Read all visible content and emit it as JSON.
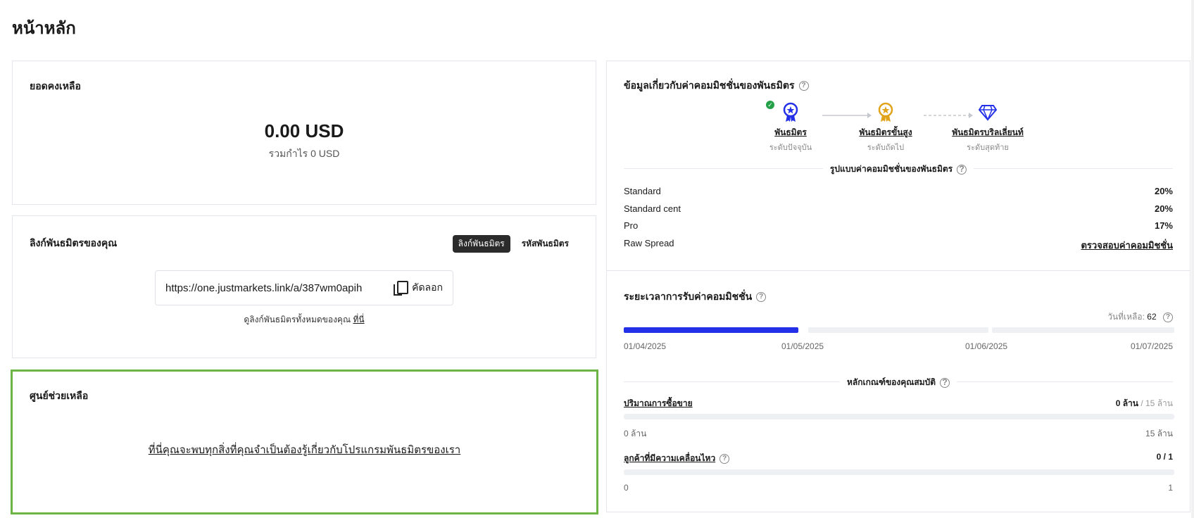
{
  "page": {
    "title": "หน้าหลัก"
  },
  "balance": {
    "title": "ยอดคงเหลือ",
    "amount": "0.00 USD",
    "total_profit": "รวมกำไร 0 USD"
  },
  "partner_link": {
    "title": "ลิงก์พันธมิตรของคุณ",
    "toggle": {
      "link_label": "ลิงก์พันธมิตร",
      "code_label": "รหัสพันธมิตร",
      "active": "link"
    },
    "url": "https://one.justmarkets.link/a/387wm0apih",
    "copy_label": "คัดลอก",
    "note_prefix": "ดูลิงก์พันธมิตรทั้งหมดของคุณ",
    "note_link": "ที่นี่"
  },
  "help_center": {
    "title": "ศูนย์ช่วยเหลือ",
    "link_text": "ที่นี่คุณจะพบทุกสิ่งที่คุณจำเป็นต้องรู้เกี่ยวกับโปรแกรมพันธมิตรของเรา"
  },
  "commission_info": {
    "title": "ข้อมูลเกี่ยวกับค่าคอมมิชชั่นของพันธมิตร",
    "help_icon": "?",
    "tiers": [
      {
        "name": "พันธมิตร",
        "status": "ระดับปัจจุบัน",
        "icon": "medal-blue-icon",
        "color": "#2430e8",
        "current": true
      },
      {
        "name": "พันธมิตรขั้นสูง",
        "status": "ระดับถัดไป",
        "icon": "medal-gold-icon",
        "color": "#e0a31a",
        "current": false
      },
      {
        "name": "พันธมิตรบริลเลี่ยนท์",
        "status": "ระดับสุดท้าย",
        "icon": "diamond-icon",
        "color": "#2430e8",
        "current": false
      }
    ],
    "format_label": "รูปแบบค่าคอมมิชชั่นของพันธมิตร",
    "rates": [
      {
        "account": "Standard",
        "value": "20%"
      },
      {
        "account": "Standard cent",
        "value": "20%"
      },
      {
        "account": "Pro",
        "value": "17%"
      },
      {
        "account": "Raw Spread",
        "value": "ตรวจสอบค่าคอมมิชชั่น",
        "is_link": true
      }
    ]
  },
  "schedule": {
    "title": "ระยะเวลาการรับค่าคอมมิชชั่น",
    "days_left_label": "วันที่เหลือ:",
    "days_left": "62",
    "dates": [
      "01/04/2025",
      "01/05/2025",
      "01/06/2025",
      "01/07/2025"
    ],
    "progress_first_segment": 1.0,
    "criteria_title": "หลักเกณฑ์ของคุณสมบัติ",
    "criteria": [
      {
        "label": "ปริมาณการซื้อขาย",
        "current": "0 ล้าน",
        "target": "/ 15 ล้าน",
        "min": "0 ล้าน",
        "max": "15 ล้าน",
        "progress": 0
      },
      {
        "label": "ลูกค้าที่มีความเคลื่อนไหว",
        "current": "0 / 1",
        "target": "",
        "min": "0",
        "max": "1",
        "progress": 0
      }
    ]
  },
  "colors": {
    "accent": "#2430e8",
    "gold": "#e0a31a",
    "success": "#24a148",
    "highlight_border": "#6cb545"
  }
}
